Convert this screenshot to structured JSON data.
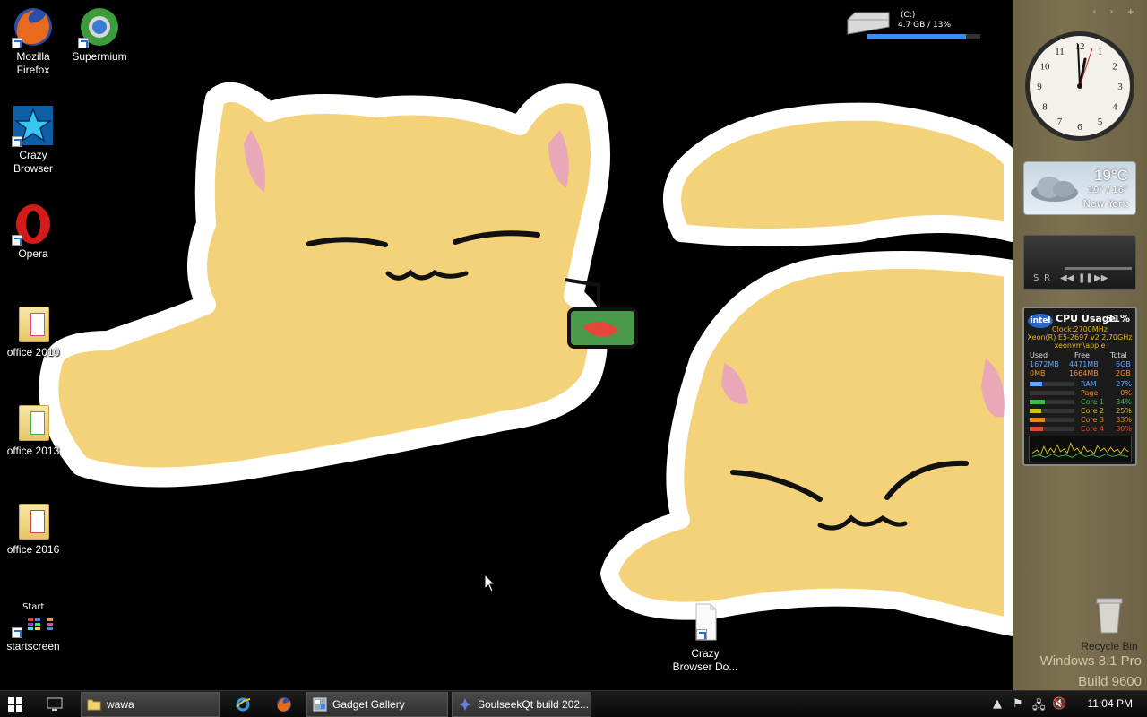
{
  "desktop": {
    "icons": [
      {
        "label": "Mozilla Firefox",
        "icon": "firefox-icon"
      },
      {
        "label": "Supermium",
        "icon": "supermium-icon"
      },
      {
        "label": "Crazy Browser",
        "icon": "crazy-browser-icon"
      },
      {
        "label": "Opera",
        "icon": "opera-icon"
      },
      {
        "label": "office 2010",
        "icon": "folder-icon"
      },
      {
        "label": "office 2013",
        "icon": "folder-icon"
      },
      {
        "label": "office 2016",
        "icon": "folder-icon"
      },
      {
        "label": "startscreen",
        "icon": "start-tiles-icon",
        "caption": "Start"
      },
      {
        "label": "Crazy Browser Do...",
        "icon": "document-icon"
      }
    ],
    "recycle_bin": "Recycle Bin",
    "watermark_line1": "Windows 8.1 Pro",
    "watermark_line2": "Build 9600"
  },
  "drive_gadget": {
    "label": "(C:)",
    "size": "4.7 GB / 13%",
    "used_fraction": 0.87,
    "color": "#3b8df0"
  },
  "weather": {
    "temp": "19°C",
    "range": "19° / 16°",
    "city": "New York"
  },
  "media": {
    "shuffle": "S",
    "repeat": "R"
  },
  "cpu": {
    "title": "CPU Usage",
    "percent": "31%",
    "clock": "Clock:2700MHz",
    "model": "Xeon(R) E5-2697 v2 2.70GHz",
    "host": "xeonvm\\apple",
    "headers": [
      "Used",
      "Free",
      "Total"
    ],
    "ram_values": [
      "1672MB",
      "4471MB",
      "6GB"
    ],
    "page_values": [
      "0MB",
      "1664MB",
      "2GB"
    ],
    "rows": [
      {
        "name": "RAM",
        "pct": "27%",
        "fraction": 0.27,
        "color": "#5fa6ff"
      },
      {
        "name": "Page",
        "pct": "0%",
        "fraction": 0.0,
        "color": "#ff8d2a"
      },
      {
        "name": "Core 1",
        "pct": "34%",
        "fraction": 0.34,
        "color": "#3fbf3f"
      },
      {
        "name": "Core 2",
        "pct": "25%",
        "fraction": 0.25,
        "color": "#d6c21c"
      },
      {
        "name": "Core 3",
        "pct": "33%",
        "fraction": 0.33,
        "color": "#e68a1c"
      },
      {
        "name": "Core 4",
        "pct": "30%",
        "fraction": 0.3,
        "color": "#e04a2a"
      }
    ]
  },
  "taskbar": {
    "tasks": [
      {
        "label": "wawa",
        "icon": "folder-icon"
      },
      {
        "label": "Gadget Gallery",
        "icon": "gadget-gallery-icon"
      },
      {
        "label": "SoulseekQt build 202...",
        "icon": "soulseek-icon"
      }
    ],
    "time": "11:04 PM"
  }
}
